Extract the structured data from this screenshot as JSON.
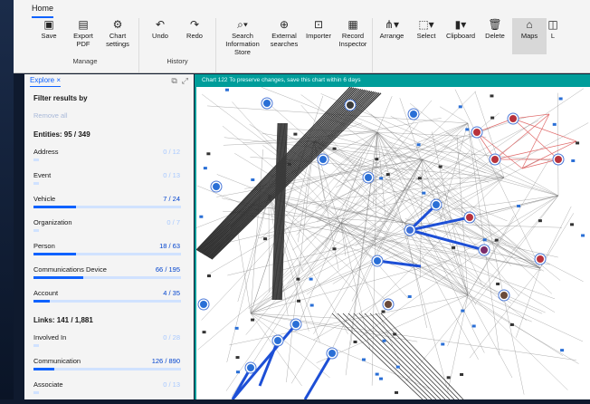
{
  "ribbon": {
    "tab": "Home",
    "buttons": {
      "save": "Save",
      "export": "Export PDF",
      "chart_settings": "Chart settings",
      "undo": "Undo",
      "redo": "Redo",
      "search": "Search Information Store",
      "external": "External searches",
      "importer": "Importer",
      "record": "Record Inspector",
      "arrange": "Arrange",
      "select": "Select",
      "clipboard": "Clipboard",
      "delete": "Delete",
      "maps": "Maps",
      "more": "L"
    },
    "groups": {
      "manage": "Manage",
      "history": "History"
    }
  },
  "explore": {
    "tab": "Explore",
    "filter_heading": "Filter results by",
    "remove_all": "Remove all",
    "entities_heading": "Entities: 95 / 349",
    "entities": [
      {
        "label": "Address",
        "count": "0 / 12",
        "fraction": 0.0
      },
      {
        "label": "Event",
        "count": "0 / 13",
        "fraction": 0.0
      },
      {
        "label": "Vehicle",
        "count": "7 / 24",
        "fraction": 0.29
      },
      {
        "label": "Organization",
        "count": "0 / 7",
        "fraction": 0.0
      },
      {
        "label": "Person",
        "count": "18 / 63",
        "fraction": 0.29
      },
      {
        "label": "Communications Device",
        "count": "66 / 195",
        "fraction": 0.34
      },
      {
        "label": "Account",
        "count": "4 / 35",
        "fraction": 0.11
      }
    ],
    "links_heading": "Links: 141 / 1,881",
    "links": [
      {
        "label": "Involved In",
        "count": "0 / 28",
        "fraction": 0.0
      },
      {
        "label": "Communication",
        "count": "126 / 890",
        "fraction": 0.14
      },
      {
        "label": "Associate",
        "count": "0 / 13",
        "fraction": 0.0
      }
    ]
  },
  "chart": {
    "title": "Chart 122   To preserve changes, save this chart within 6 days"
  },
  "colors": {
    "accent": "#0f62fe",
    "teal": "#009d9a",
    "link_red": "#e06a6a"
  }
}
